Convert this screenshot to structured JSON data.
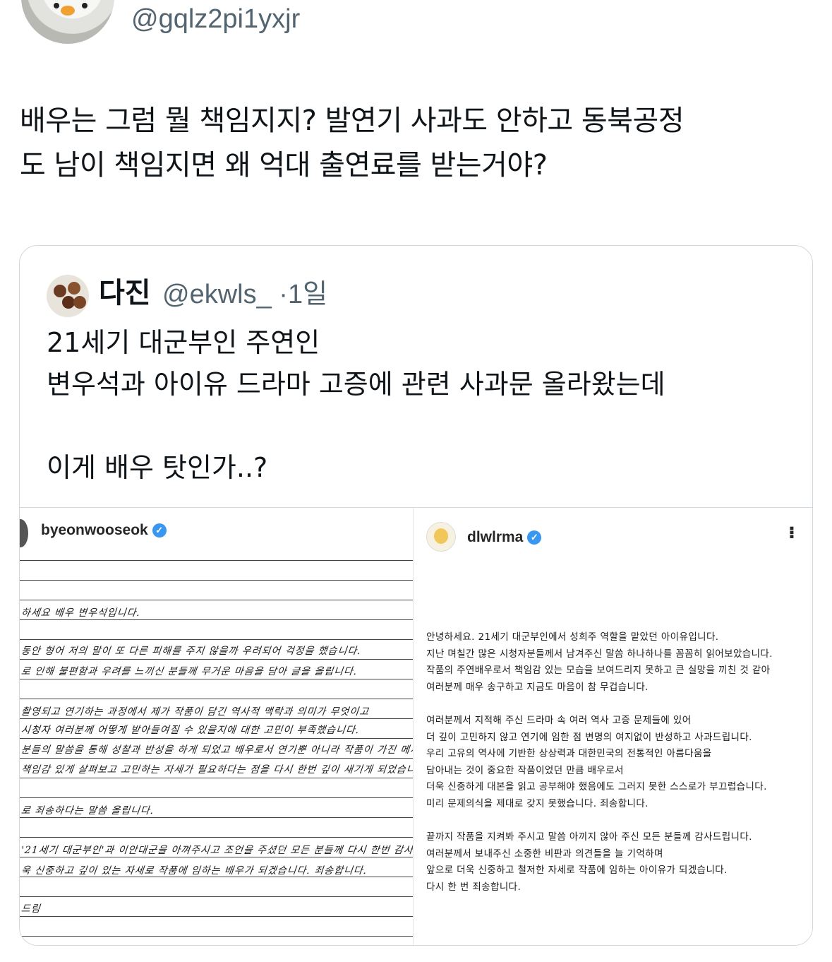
{
  "tweet": {
    "handle": "@gqlz2pi1yxjr",
    "text_lines": [
      "배우는 그럼 뭘 책임지지? 발연기 사과도 안하고 동북공정",
      "도 남이 책임지면 왜 억대 출연료를 받는거야?"
    ]
  },
  "quote": {
    "name": "다진",
    "handle_time": "@ekwls_ ·1일",
    "lines": [
      "21세기 대군부인 주연인",
      "변우석과 아이유 드라마 고증에 관련 사과문 올라왔는데",
      "",
      "이게 배우 탓인가..?"
    ]
  },
  "left_post": {
    "username": "byeonwooseok",
    "handwritten": [
      "하세요 배우 변우석입니다.",
      "동안 형어 저의 말이 또 다른 피해를 주지 않을까 우려되어 걱정을 했습니다.",
      "로 인해 불편함과 우려를 느끼신 분들께 무거운 마음을 담아 글을 올립니다.",
      "촬영되고 연기하는 과정에서 제가 작품이 담긴 역사적 맥락과 의미가 무엇이고",
      "시청자 여러분께 어떻게 받아들여질 수 있을지에 대한 고민이 부족했습니다.",
      "분들의 말씀을 통해 성찰과 반성을 하게 되었고 배우로서 연기뿐 아니라 작품이 가진 메시지와 맥락까",
      "책임감 있게 살펴보고 고민하는 자세가 필요하다는 점을 다시 한번 깊이 새기게 되었습니다.",
      "로 죄송하다는 말씀 올립니다.",
      "'21세기 대군부인'과 이안대군을 아껴주시고 조언을 주셨던 모든 분들께 다시 한번 감사드리며",
      "욱 신중하고 깊이 있는 자세로 작품에 임하는 배우가 되겠습니다. 죄송합니다.",
      "드림"
    ]
  },
  "right_post": {
    "username": "dlwlrma",
    "letter_lines": [
      "안녕하세요. 21세기 대군부인에서 성희주 역할을 맡았던 아이유입니다.",
      "지난 며칠간 많은 시청자분들께서 남겨주신 말씀 하나하나를 꼼꼼히 읽어보았습니다.",
      "작품의 주연배우로서 책임감 있는 모습을 보여드리지 못하고 큰 실망을 끼친 것 같아",
      "여러분께 매우 송구하고 지금도 마음이 참 무겁습니다.",
      "",
      "여러분께서 지적해 주신 드라마 속 여러 역사 고증 문제들에 있어",
      "더 깊이 고민하지 않고 연기에 임한 점 변명의 여지없이 반성하고 사과드립니다.",
      "우리 고유의 역사에 기반한 상상력과 대한민국의 전통적인 아름다움을",
      "담아내는 것이 중요한 작품이었던 만큼 배우로서",
      "더욱 신중하게 대본을 읽고 공부해야 했음에도 그러지 못한 스스로가 부끄럽습니다.",
      "미리 문제의식을 제대로 갖지 못했습니다. 죄송합니다.",
      "",
      "끝까지 작품을 지켜봐 주시고 말씀 아끼지 않아 주신 모든 분들께 감사드립니다.",
      "여러분께서 보내주신 소중한 비판과 의견들을 늘 기억하며",
      "앞으로 더욱 신중하고 철저한 자세로 작품에 임하는 아이유가 되겠습니다.",
      "다시 한 번 죄송합니다."
    ]
  },
  "colors": {
    "text": "#0f1419",
    "muted": "#536471",
    "border": "#cfd9de",
    "verified": "#3897f0"
  }
}
